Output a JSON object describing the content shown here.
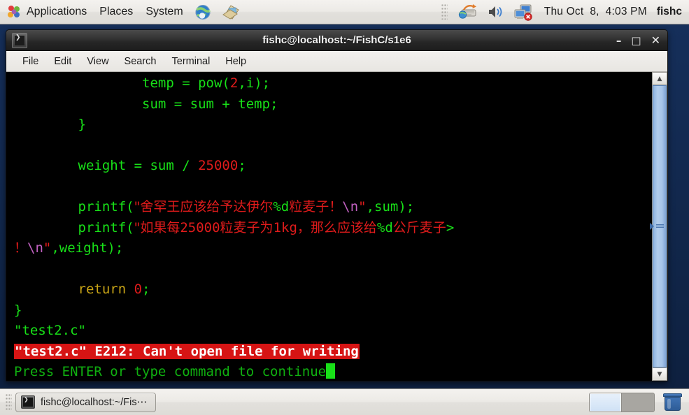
{
  "desktop": {
    "top_panel": {
      "menus": [
        {
          "label": "Applications",
          "icon": "applications-logo-icon"
        },
        {
          "label": "Places",
          "icon": null
        },
        {
          "label": "System",
          "icon": null
        }
      ],
      "launchers": [
        {
          "icon": "web-browser-icon",
          "name": "browser-launcher"
        },
        {
          "icon": "email-client-icon",
          "name": "email-launcher"
        }
      ],
      "tray": [
        {
          "icon": "network-settings-icon",
          "name": "network-tray-icon"
        },
        {
          "icon": "volume-speaker-icon",
          "name": "volume-tray-icon"
        },
        {
          "icon": "network-disconnected-icon",
          "name": "network-status-tray-icon"
        }
      ],
      "clock": "Thu Oct  8,  4:03 PM",
      "user": "fishc"
    },
    "taskbar": {
      "window_button": {
        "label": "fishc@localhost:~/Fis⋯",
        "icon": "terminal-icon"
      },
      "workspaces": [
        {
          "name": "workspace-1",
          "active": true
        },
        {
          "name": "workspace-2",
          "active": false
        }
      ],
      "trash": {
        "name": "trash-icon",
        "label": "Trash"
      }
    }
  },
  "terminal": {
    "title": "fishc@localhost:~/FishC/s1e6",
    "window_icon": "terminal-icon",
    "window_buttons": {
      "minimize": "–",
      "maximize": "□",
      "close": "✕"
    },
    "menu": [
      "File",
      "Edit",
      "View",
      "Search",
      "Terminal",
      "Help"
    ],
    "scrollbar": {
      "up_arrow": "▲",
      "down_arrow": "▼"
    },
    "colors": {
      "background": "#000000",
      "green": "#18e018",
      "dim_green": "#10b010",
      "red": "#e01b1b",
      "yellow": "#c8a416",
      "magenta": "#c060c0",
      "error_background": "#d61414",
      "error_foreground": "#ffffff",
      "cursor": "#18e018"
    },
    "lines": [
      {
        "name": "code-line-temp",
        "spans": [
          {
            "text": "                temp = pow(",
            "class": "g"
          },
          {
            "text": "2",
            "class": "r"
          },
          {
            "text": ",i);",
            "class": "g"
          }
        ]
      },
      {
        "name": "code-line-sum",
        "spans": [
          {
            "text": "                sum = sum + temp;",
            "class": "g"
          }
        ]
      },
      {
        "name": "code-line-close-brace-inner",
        "spans": [
          {
            "text": "        }",
            "class": "g"
          }
        ]
      },
      {
        "name": "code-line-blank-1",
        "spans": [
          {
            "text": " ",
            "class": "g"
          }
        ]
      },
      {
        "name": "code-line-weight",
        "spans": [
          {
            "text": "        weight = sum / ",
            "class": "g"
          },
          {
            "text": "25000",
            "class": "r"
          },
          {
            "text": ";",
            "class": "g"
          }
        ]
      },
      {
        "name": "code-line-blank-2",
        "spans": [
          {
            "text": " ",
            "class": "g"
          }
        ]
      },
      {
        "name": "code-line-printf-1",
        "spans": [
          {
            "text": "        printf(",
            "class": "g"
          },
          {
            "text": "\"舍罕王应该给予达伊尔",
            "class": "r cjk"
          },
          {
            "text": "%d",
            "class": "g"
          },
          {
            "text": "粒麦子！",
            "class": "r cjk"
          },
          {
            "text": "\\n",
            "class": "m"
          },
          {
            "text": "\"",
            "class": "r"
          },
          {
            "text": ",sum);",
            "class": "g"
          }
        ]
      },
      {
        "name": "code-line-printf-2",
        "spans": [
          {
            "text": "        printf(",
            "class": "g"
          },
          {
            "text": "\"如果每",
            "class": "r cjk"
          },
          {
            "text": "25000",
            "class": "r"
          },
          {
            "text": "粒麦子为",
            "class": "r cjk"
          },
          {
            "text": "1kg",
            "class": "r"
          },
          {
            "text": "，那么应该给",
            "class": "r cjk"
          },
          {
            "text": "%d",
            "class": "g"
          },
          {
            "text": "公斤麦子",
            "class": "r cjk"
          },
          {
            "text": ">",
            "class": "g"
          }
        ]
      },
      {
        "name": "code-line-printf-2-wrap",
        "spans": [
          {
            "text": "！",
            "class": "r cjk"
          },
          {
            "text": "\\n",
            "class": "m"
          },
          {
            "text": "\"",
            "class": "r"
          },
          {
            "text": ",weight);",
            "class": "g"
          }
        ]
      },
      {
        "name": "code-line-blank-3",
        "spans": [
          {
            "text": " ",
            "class": "g"
          }
        ]
      },
      {
        "name": "code-line-return",
        "spans": [
          {
            "text": "        return ",
            "class": "y"
          },
          {
            "text": "0",
            "class": "r"
          },
          {
            "text": ";",
            "class": "g"
          }
        ]
      },
      {
        "name": "code-line-close-brace-outer",
        "spans": [
          {
            "text": "}",
            "class": "g"
          }
        ]
      },
      {
        "name": "vim-status-filename",
        "spans": [
          {
            "text": "\"test2.c\"",
            "class": "g"
          }
        ]
      },
      {
        "name": "vim-error-message",
        "spans": [
          {
            "text": "\"test2.c\" E212: Can't open file for writing",
            "class": "errbar"
          }
        ]
      },
      {
        "name": "vim-prompt-continue",
        "spans": [
          {
            "text": "Press ENTER or type command to continue",
            "class": "gd"
          },
          {
            "text": "",
            "class": "cursor"
          }
        ]
      }
    ]
  }
}
